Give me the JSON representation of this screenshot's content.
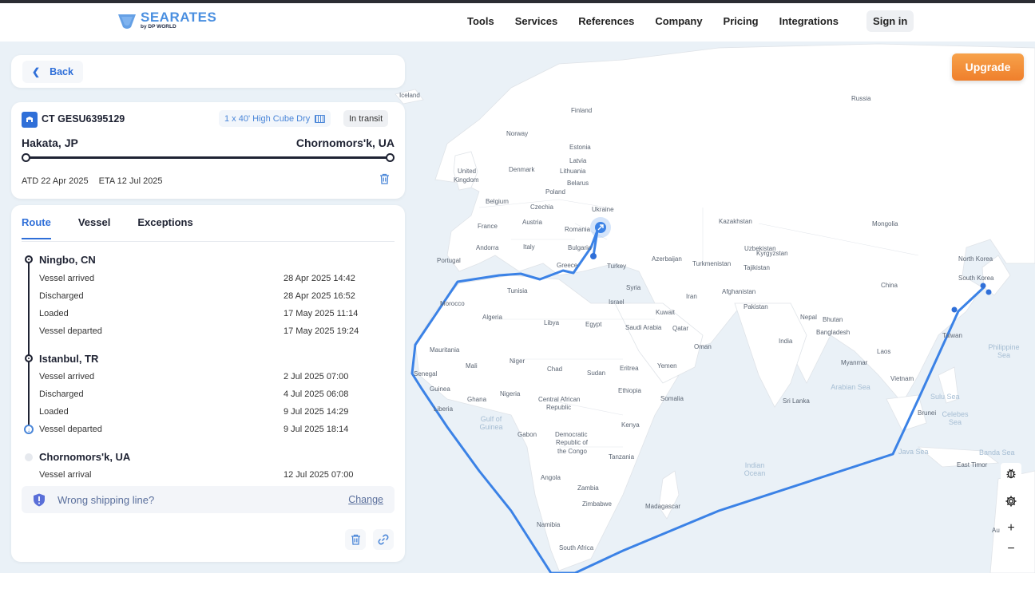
{
  "header": {
    "logo": {
      "brand": "SEARATES",
      "sub": "by DP WORLD"
    },
    "nav": [
      "Tools",
      "Services",
      "References",
      "Company",
      "Pricing",
      "Integrations"
    ],
    "sign_in": "Sign in"
  },
  "back_label": "Back",
  "shipment": {
    "container_id": "CT GESU6395129",
    "container_type": "1 x 40' High Cube Dry",
    "status": "In transit",
    "origin": "Hakata, JP",
    "destination": "Chornomors'k, UA",
    "atd": "ATD 22 Apr 2025",
    "eta": "ETA 12 Jul 2025"
  },
  "tabs": [
    "Route",
    "Vessel",
    "Exceptions"
  ],
  "route": [
    {
      "port": "Ningbo, CN",
      "events": [
        {
          "label": "Vessel arrived",
          "time": "28 Apr 2025 14:42"
        },
        {
          "label": "Discharged",
          "time": "28 Apr 2025 16:52"
        },
        {
          "label": "Loaded",
          "time": "17 May 2025 11:14"
        },
        {
          "label": "Vessel departed",
          "time": "17 May 2025 19:24"
        }
      ]
    },
    {
      "port": "Istanbul, TR",
      "events": [
        {
          "label": "Vessel arrived",
          "time": "2 Jul 2025 07:00"
        },
        {
          "label": "Discharged",
          "time": "4 Jul 2025 06:08"
        },
        {
          "label": "Loaded",
          "time": "9 Jul 2025 14:29"
        },
        {
          "label": "Vessel departed",
          "time": "9 Jul 2025 18:14"
        }
      ]
    },
    {
      "port": "Chornomors'k, UA",
      "events": [
        {
          "label": "Vessel arrival",
          "time": "12 Jul 2025 07:00"
        }
      ]
    }
  ],
  "warning": {
    "text": "Wrong shipping line?",
    "action": "Change"
  },
  "map": {
    "upgrade": "Upgrade",
    "zoom_in": "+",
    "zoom_out": "−",
    "route_color": "#3b82e6",
    "labels": {
      "iceland": "Iceland",
      "finland": "Finland",
      "russia": "Russia",
      "norway": "Norway",
      "estonia": "Estonia",
      "latvia": "Latvia",
      "denmark": "Denmark",
      "lithuania": "Lithuania",
      "uk1": "United",
      "uk2": "Kingdom",
      "belarus": "Belarus",
      "poland": "Poland",
      "belgium": "Belgium",
      "czechia": "Czechia",
      "ukraine": "Ukraine",
      "kazakhstan": "Kazakhstan",
      "mongolia": "Mongolia",
      "france": "France",
      "austria": "Austria",
      "romania": "Romania",
      "bulgaria": "Bulgaria",
      "andorra": "Andorra",
      "italy": "Italy",
      "greece": "Greece",
      "turkey": "Turkey",
      "azerbaijan": "Azerbaijan",
      "turkmenistan": "Turkmenistan",
      "uzbekistan": "Uzbekistan",
      "kyrgyzstan": "Kyrgyzstan",
      "tajikistan": "Tajikistan",
      "portugal": "Portugal",
      "northkorea": "North Korea",
      "southkorea": "South Korea",
      "china": "China",
      "syria": "Syria",
      "afghanistan": "Afghanistan",
      "tunisia": "Tunisia",
      "iran": "Iran",
      "israel": "Israel",
      "kuwait": "Kuwait",
      "pakistan": "Pakistan",
      "morocco": "Morocco",
      "nepal": "Nepal",
      "bhutan": "Bhutan",
      "algeria": "Algeria",
      "libya": "Libya",
      "egypt": "Egypt",
      "saudi": "Saudi Arabia",
      "qatar": "Qatar",
      "bangladesh": "Bangladesh",
      "taiwan": "Taiwan",
      "india": "India",
      "oman": "Oman",
      "mauritania": "Mauritania",
      "laos": "Laos",
      "mali": "Mali",
      "niger": "Niger",
      "myanmar": "Myanmar",
      "chad": "Chad",
      "sudan": "Sudan",
      "eritrea": "Eritrea",
      "yemen": "Yemen",
      "senegal": "Senegal",
      "vietnam": "Vietnam",
      "guinea": "Guinea",
      "nigeria": "Nigeria",
      "ethiopia": "Ethiopia",
      "ghana": "Ghana",
      "car1": "Central African",
      "car2": "Republic",
      "somalia": "Somalia",
      "srilanka": "Sri Lanka",
      "liberia": "Liberia",
      "brunei": "Brunei",
      "gabon": "Gabon",
      "drc1": "Democratic",
      "drc2": "Republic of",
      "drc3": "the Congo",
      "kenya": "Kenya",
      "tanzania": "Tanzania",
      "angola": "Angola",
      "zambia": "Zambia",
      "zimbabwe": "Zimbabwe",
      "madagascar": "Madagascar",
      "namibia": "Namibia",
      "southafrica": "South Africa",
      "easttimor": "East Timor",
      "au": "Au",
      "philippine_sea": "Philippine Sea",
      "arabian_sea": "Arabian Sea",
      "sulu_sea": "Sulu Sea",
      "celebes_sea": "Celebes Sea",
      "java_sea": "Java Sea",
      "banda_sea": "Banda Sea",
      "gulf_guinea": "Gulf of Guinea",
      "indian_ocean": "Indian Ocean"
    }
  }
}
